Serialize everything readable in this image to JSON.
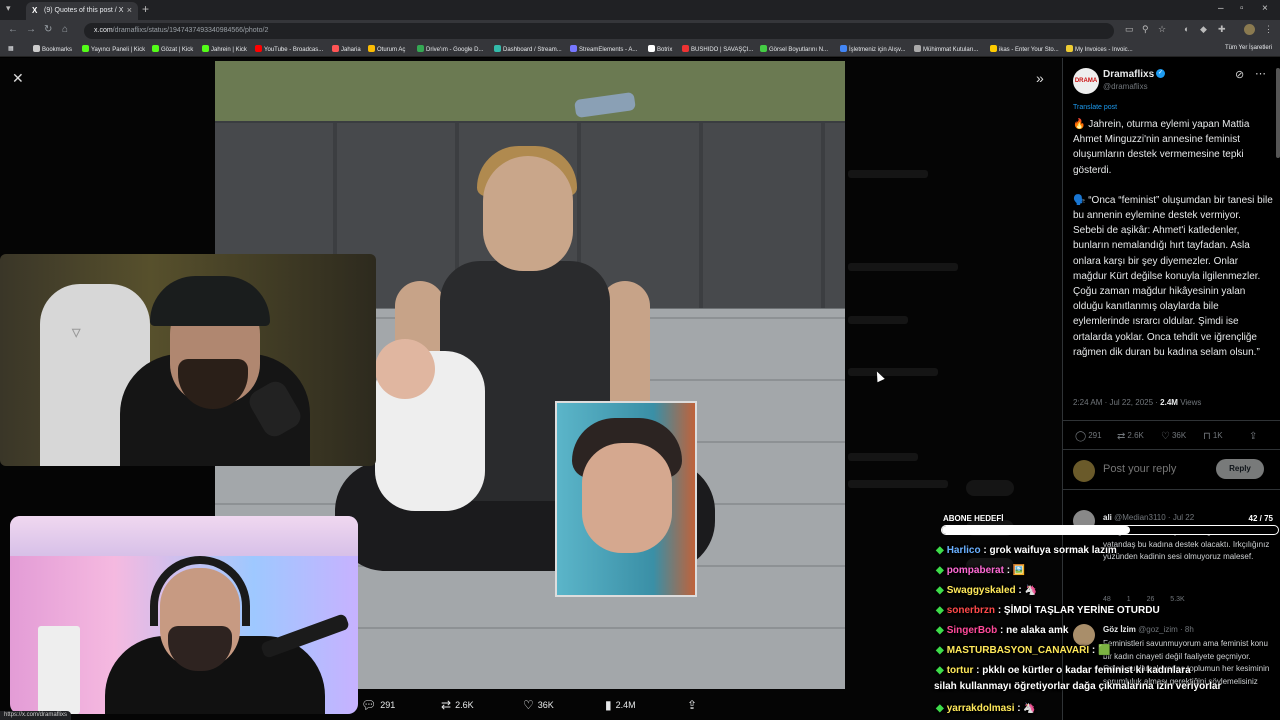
{
  "browser": {
    "tab_title": "(9) Quotes of this post / X",
    "url_domain": "x.com",
    "url_path": "/dramaflixs/status/1947437493340984566/photo/2",
    "bookmarks": [
      "Bookmarks",
      "Yayıncı Paneli | Kick",
      "Gözat | Kick",
      "Jahrein | Kick",
      "YouTube - Broadcas...",
      "Jaharia",
      "Oturum Aç",
      "Drive'ım - Google D...",
      "Dashboard / Stream...",
      "StreamElements - A...",
      "Botrix",
      "BUSHIDO | SAVAŞÇI...",
      "Görsel Boyutlarını N...",
      "İşletmeniz için Alışv...",
      "Mühimmat Kutuları...",
      "ikas - Enter Your Sto...",
      "My Invoices - Invoic..."
    ],
    "bookmarks_right": "Tüm Yer İşaretleri",
    "status_url": "https://x.com/dramaflixs"
  },
  "viewer": {
    "actions": {
      "replies": "291",
      "reposts": "2.6K",
      "likes": "36K",
      "views": "2.4M"
    }
  },
  "tweet": {
    "author_name": "Dramaflixs",
    "author_handle": "@dramaflixs",
    "avatar_text": "DRAMA",
    "translate_label": "Translate post",
    "text_p1": "🔥 Jahrein, oturma eylemi yapan Mattia Ahmet Minguzzi'nin annesine feminist oluşumların destek vermemesine tepki gösterdi.",
    "text_p2": "🗣️ “Onca “feminist” oluşumdan bir tanesi bile bu annenin eylemine destek vermiyor. Sebebi de aşikâr: Ahmet'i katledenler, bunların nemalandığı hırt tayfadan. Asla onlara karşı bir şey diyemezler. Onlar mağdur Kürt değilse konuyla ilgilenmezler. Çoğu zaman mağdur hikâyesinin yalan olduğu kanıtlanmış olaylarda bile eylemlerinde ısrarcı oldular. Şimdi ise ortalarda yoklar. Onca tehdit ve iğrençliğe rağmen dik duran bu kadına selam olsun.”",
    "time": "2:24 AM · Jul 22, 2025 · ",
    "views_count": "2.4M",
    "views_label": " Views",
    "metrics": {
      "replies": "291",
      "reposts": "2.6K",
      "likes": "36K",
      "bookmarks": "1K"
    },
    "reply_placeholder": "Post your reply",
    "reply_button": "Reply"
  },
  "replies": [
    {
      "name": "ali",
      "handle": "@Median3110 · Jul 22",
      "text": "...nliğine saldırmasaydınız bugün binlerce Kürt vatandaş bu kadına destek olacaktı. Irkçılığınız yüzünden kadinin sesi olmuyoruz malesef.",
      "metrics": "48  1  26  5.3K"
    },
    {
      "name": "Göz İzim",
      "handle": "@goz_izim · 8h",
      "text": "Feministleri savunmuyorum ama feminist konu bir kadın cinayeti değil faaliyete geçmiyor. Onları suçlamak yerine toplumun her kesiminin sorumluluk alması gerektiğini söylemelisiniz"
    }
  ],
  "overlay": {
    "goal_label": "ABONE HEDEFİ",
    "goal_count": "42 / 75",
    "goal_current": 42,
    "goal_target": 75
  },
  "chat": [
    {
      "user": "Harlico",
      "color": "#6ab0ff",
      "text": " : grok waifuya sormak lazım"
    },
    {
      "user": "pompaberat",
      "color": "#ff6ad5",
      "text": " : 🖼️"
    },
    {
      "user": "Swaggyskaled",
      "color": "#ffe95a",
      "text": " : 🦄"
    },
    {
      "user": "sonerbrzn",
      "color": "#ff4a4a",
      "text": " : ŞİMDİ TAŞLAR YERİNE OTURDU"
    },
    {
      "user": "SingerBob",
      "color": "#ff4a9a",
      "text": " : ne alaka amk"
    },
    {
      "user": "MASTURBASYON_CANAVARI",
      "color": "#ffe95a",
      "text": " : 🟩"
    },
    {
      "user": "tortur",
      "color": "#ffe95a",
      "text": " : pkklı oe kürtler o kadar feminist ki kadınlara"
    },
    {
      "user": "",
      "color": "#ffffff",
      "text": "silah kullanmayı öğretiyorlar dağa çıkmalarına izin veriyorlar"
    },
    {
      "user": "yarrakdolmasi",
      "color": "#ffe95a",
      "text": " : 🦄"
    }
  ],
  "colors": {
    "accent": "#1d9bf0",
    "chat_badge": "#3ddc4a"
  }
}
